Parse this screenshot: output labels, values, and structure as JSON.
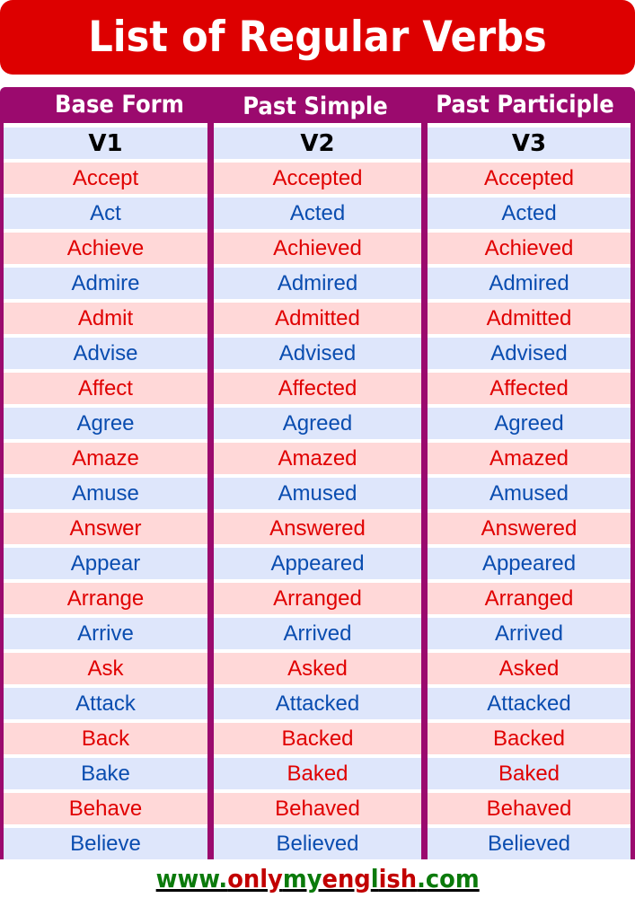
{
  "title": "List of Regular Verbs",
  "colors": {
    "title_bg": "#dd0000",
    "header_bg": "#9b0a6e",
    "row_blue_bg": "#dee6fb",
    "row_pink_bg": "#ffd8d8",
    "text_red": "#e00000",
    "text_blue": "#0a4db0",
    "url_green": "#0b7a0b",
    "url_red": "#c20000"
  },
  "columns": [
    {
      "header": "Base Form",
      "form": "V1"
    },
    {
      "header": "Past Simple",
      "form": "V2"
    },
    {
      "header": "Past Participle",
      "form": "V3"
    }
  ],
  "rows": [
    {
      "bg": "pink",
      "cells": [
        {
          "text": "Accept",
          "color": "red"
        },
        {
          "text": "Accepted",
          "color": "red"
        },
        {
          "text": "Accepted",
          "color": "red"
        }
      ]
    },
    {
      "bg": "blue",
      "cells": [
        {
          "text": "Act",
          "color": "blue"
        },
        {
          "text": "Acted",
          "color": "blue"
        },
        {
          "text": "Acted",
          "color": "blue"
        }
      ]
    },
    {
      "bg": "pink",
      "cells": [
        {
          "text": "Achieve",
          "color": "red"
        },
        {
          "text": "Achieved",
          "color": "red"
        },
        {
          "text": "Achieved",
          "color": "red"
        }
      ]
    },
    {
      "bg": "blue",
      "cells": [
        {
          "text": "Admire",
          "color": "blue"
        },
        {
          "text": "Admired",
          "color": "blue"
        },
        {
          "text": "Admired",
          "color": "blue"
        }
      ]
    },
    {
      "bg": "pink",
      "cells": [
        {
          "text": "Admit",
          "color": "red"
        },
        {
          "text": "Admitted",
          "color": "red"
        },
        {
          "text": "Admitted",
          "color": "red"
        }
      ]
    },
    {
      "bg": "blue",
      "cells": [
        {
          "text": "Advise",
          "color": "blue"
        },
        {
          "text": "Advised",
          "color": "blue"
        },
        {
          "text": "Advised",
          "color": "blue"
        }
      ]
    },
    {
      "bg": "pink",
      "cells": [
        {
          "text": "Affect",
          "color": "red"
        },
        {
          "text": "Affected",
          "color": "red"
        },
        {
          "text": "Affected",
          "color": "red"
        }
      ]
    },
    {
      "bg": "blue",
      "cells": [
        {
          "text": "Agree",
          "color": "blue"
        },
        {
          "text": "Agreed",
          "color": "blue"
        },
        {
          "text": "Agreed",
          "color": "blue"
        }
      ]
    },
    {
      "bg": "pink",
      "cells": [
        {
          "text": "Amaze",
          "color": "red"
        },
        {
          "text": "Amazed",
          "color": "red"
        },
        {
          "text": "Amazed",
          "color": "red"
        }
      ]
    },
    {
      "bg": "blue",
      "cells": [
        {
          "text": "Amuse",
          "color": "blue"
        },
        {
          "text": "Amused",
          "color": "blue"
        },
        {
          "text": "Amused",
          "color": "blue"
        }
      ]
    },
    {
      "bg": "pink",
      "cells": [
        {
          "text": "Answer",
          "color": "red"
        },
        {
          "text": "Answered",
          "color": "red"
        },
        {
          "text": "Answered",
          "color": "red"
        }
      ]
    },
    {
      "bg": "blue",
      "cells": [
        {
          "text": "Appear",
          "color": "blue"
        },
        {
          "text": "Appeared",
          "color": "blue"
        },
        {
          "text": "Appeared",
          "color": "blue"
        }
      ]
    },
    {
      "bg": "pink",
      "cells": [
        {
          "text": "Arrange",
          "color": "red"
        },
        {
          "text": "Arranged",
          "color": "red"
        },
        {
          "text": "Arranged",
          "color": "red"
        }
      ]
    },
    {
      "bg": "blue",
      "cells": [
        {
          "text": "Arrive",
          "color": "blue"
        },
        {
          "text": "Arrived",
          "color": "blue"
        },
        {
          "text": "Arrived",
          "color": "blue"
        }
      ]
    },
    {
      "bg": "pink",
      "cells": [
        {
          "text": "Ask",
          "color": "red"
        },
        {
          "text": "Asked",
          "color": "red"
        },
        {
          "text": "Asked",
          "color": "red"
        }
      ]
    },
    {
      "bg": "blue",
      "cells": [
        {
          "text": "Attack",
          "color": "blue"
        },
        {
          "text": "Attacked",
          "color": "blue"
        },
        {
          "text": "Attacked",
          "color": "blue"
        }
      ]
    },
    {
      "bg": "pink",
      "cells": [
        {
          "text": "Back",
          "color": "red"
        },
        {
          "text": "Backed",
          "color": "red"
        },
        {
          "text": "Backed",
          "color": "red"
        }
      ]
    },
    {
      "bg": "blue",
      "cells": [
        {
          "text": "Bake",
          "color": "blue"
        },
        {
          "text": "Baked",
          "color": "red"
        },
        {
          "text": "Baked",
          "color": "red"
        }
      ]
    },
    {
      "bg": "pink",
      "cells": [
        {
          "text": "Behave",
          "color": "red"
        },
        {
          "text": "Behaved",
          "color": "red"
        },
        {
          "text": "Behaved",
          "color": "red"
        }
      ]
    },
    {
      "bg": "blue",
      "cells": [
        {
          "text": "Believe",
          "color": "blue"
        },
        {
          "text": "Believed",
          "color": "blue"
        },
        {
          "text": "Believed",
          "color": "blue"
        }
      ]
    }
  ],
  "footer": {
    "url_segments": [
      {
        "text": "www.",
        "color": "green"
      },
      {
        "text": "only",
        "color": "red"
      },
      {
        "text": "my",
        "color": "green"
      },
      {
        "text": "eng",
        "color": "red"
      },
      {
        "text": "l",
        "color": "green"
      },
      {
        "text": "ish",
        "color": "red"
      },
      {
        "text": ".com",
        "color": "green"
      }
    ]
  }
}
